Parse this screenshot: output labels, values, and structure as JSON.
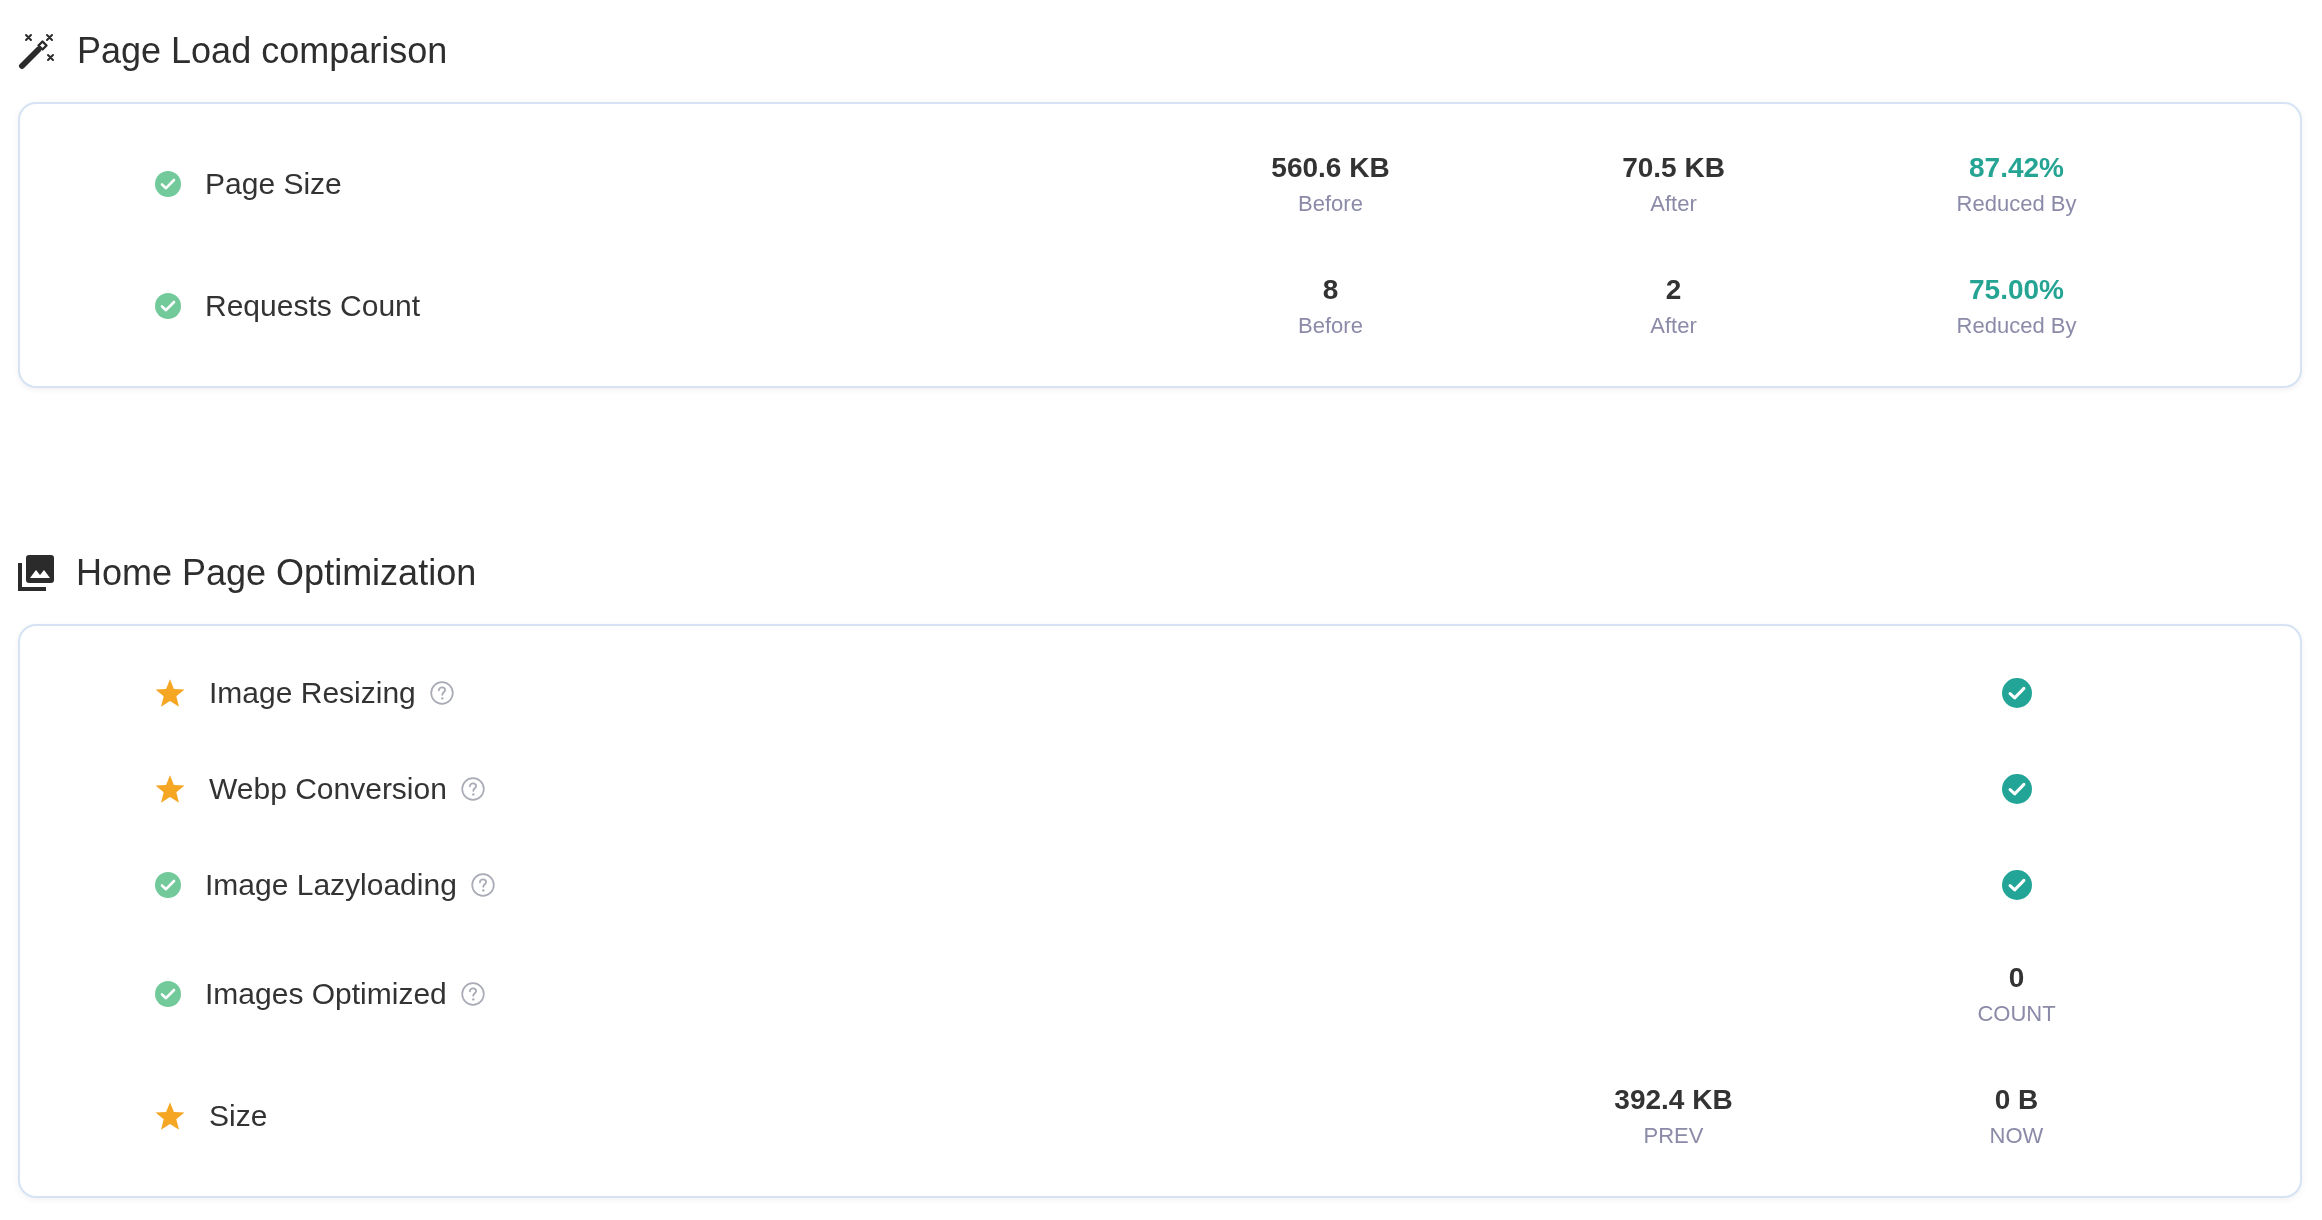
{
  "page_load_comparison": {
    "title": "Page Load comparison",
    "rows": [
      {
        "label": "Page Size",
        "kind": "check",
        "stats": [
          {
            "value": "560.6 KB",
            "caption": "Before",
            "highlight": false
          },
          {
            "value": "70.5 KB",
            "caption": "After",
            "highlight": false
          },
          {
            "value": "87.42%",
            "caption": "Reduced By",
            "highlight": true
          }
        ]
      },
      {
        "label": "Requests Count",
        "kind": "check",
        "stats": [
          {
            "value": "8",
            "caption": "Before",
            "highlight": false
          },
          {
            "value": "2",
            "caption": "After",
            "highlight": false
          },
          {
            "value": "75.00%",
            "caption": "Reduced By",
            "highlight": true
          }
        ]
      }
    ]
  },
  "home_page_optimization": {
    "title": "Home Page Optimization",
    "rows": [
      {
        "label": "Image Resizing",
        "kind": "star",
        "help": true,
        "result": {
          "kind": "check"
        }
      },
      {
        "label": "Webp Conversion",
        "kind": "star",
        "help": true,
        "result": {
          "kind": "check"
        }
      },
      {
        "label": "Image Lazyloading",
        "kind": "check",
        "help": true,
        "result": {
          "kind": "check"
        }
      },
      {
        "label": "Images Optimized",
        "kind": "check",
        "help": true,
        "result": {
          "kind": "stats",
          "stats": [
            {
              "value": "0",
              "caption": "COUNT"
            }
          ]
        }
      },
      {
        "label": "Size",
        "kind": "star",
        "help": false,
        "result": {
          "kind": "stats",
          "stats": [
            {
              "value": "392.4 KB",
              "caption": "PREV"
            },
            {
              "value": "0 B",
              "caption": "NOW"
            }
          ]
        }
      }
    ]
  }
}
